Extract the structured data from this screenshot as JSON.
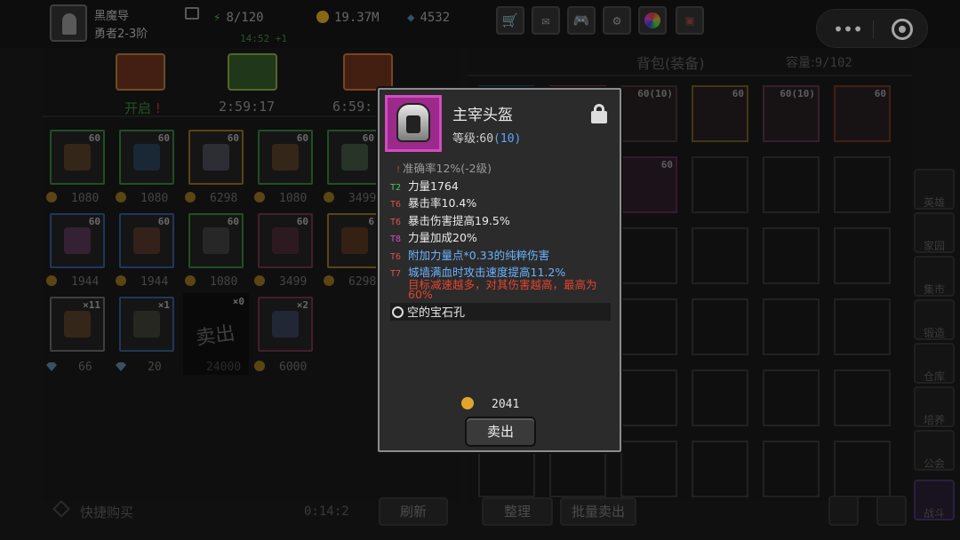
{
  "player": {
    "name": "黑魔导",
    "rank": "勇者2-3阶"
  },
  "resources": {
    "energy": "8/120",
    "energy_timer": "14:52 +1",
    "gold": "19.37M",
    "gems": "4532"
  },
  "top_buttons": [
    "shop-icon",
    "mail-icon",
    "gamepad-icon",
    "gear-icon",
    "color-wheel-icon",
    "gift-icon"
  ],
  "chests": [
    {
      "label": "开启",
      "badge": "!"
    },
    {
      "label": "2:59:17"
    },
    {
      "label": "6:59:"
    }
  ],
  "shop": {
    "rows": [
      {
        "levels": [
          "60",
          "60",
          "60",
          "60",
          "60"
        ],
        "prices": [
          "1080",
          "1080",
          "6298",
          "1080",
          "3499"
        ]
      },
      {
        "levels": [
          "60",
          "60",
          "60",
          "60",
          "6"
        ],
        "prices": [
          "1944",
          "1944",
          "1080",
          "3499",
          "6298"
        ]
      },
      {
        "items": [
          {
            "count": "×11",
            "price": "66",
            "cur": "gem"
          },
          {
            "count": "×1",
            "price": "20",
            "cur": "gem"
          },
          {
            "count": "×0",
            "price": "24000",
            "cur": "gold",
            "overlay": "卖出"
          },
          {
            "count": "×2",
            "price": "6000",
            "cur": "gold"
          }
        ]
      }
    ],
    "quick_buy": "快捷购买",
    "refresh_timer": "0:14:2",
    "refresh": "刷新"
  },
  "bag": {
    "title": "背包(装备)",
    "capacity_label": "容量:",
    "capacity": "9/102",
    "levels": [
      "60(10)",
      "60(10)",
      "60",
      "60(10)",
      "60",
      "60"
    ],
    "sort": "整理",
    "bulk_sell": "批量卖出"
  },
  "side_menu": [
    "英雄",
    "家园",
    "集市",
    "锻造",
    "仓库",
    "培养",
    "公会",
    "战斗"
  ],
  "popup": {
    "name": "主宰头盔",
    "level_label": "等级:",
    "level": "60",
    "level_bonus": "(10)",
    "attributes": [
      {
        "tier": "!",
        "text": "准确率12%(-2级)",
        "color": "#9a9a9a"
      },
      {
        "tier": "T2",
        "text": "力量1764",
        "color": "#eaeaea",
        "tier_color": "#4fc15a"
      },
      {
        "tier": "T6",
        "text": "暴击率10.4%",
        "color": "#eaeaea",
        "tier_color": "#e0504a"
      },
      {
        "tier": "T6",
        "text": "暴击伤害提高19.5%",
        "color": "#eaeaea",
        "tier_color": "#e0504a"
      },
      {
        "tier": "T8",
        "text": "力量加成20%",
        "color": "#eaeaea",
        "tier_color": "#d34dbb"
      },
      {
        "tier": "T6",
        "text": "附加力量点*0.33的纯粹伤害",
        "color": "#6bb3ff",
        "tier_color": "#e0504a"
      },
      {
        "tier": "T7",
        "text": "城墙满血时攻击速度提高11.2%",
        "color": "#6bb3ff",
        "tier_color": "#e0504a"
      },
      {
        "tier": "",
        "text": "目标减速越多，对其伤害越高，最高为",
        "color": "#e2452f"
      },
      {
        "tier": "",
        "text": "60%",
        "color": "#e2452f"
      }
    ],
    "gem_slot": "空的宝石孔",
    "price": "2041",
    "sell": "卖出"
  }
}
